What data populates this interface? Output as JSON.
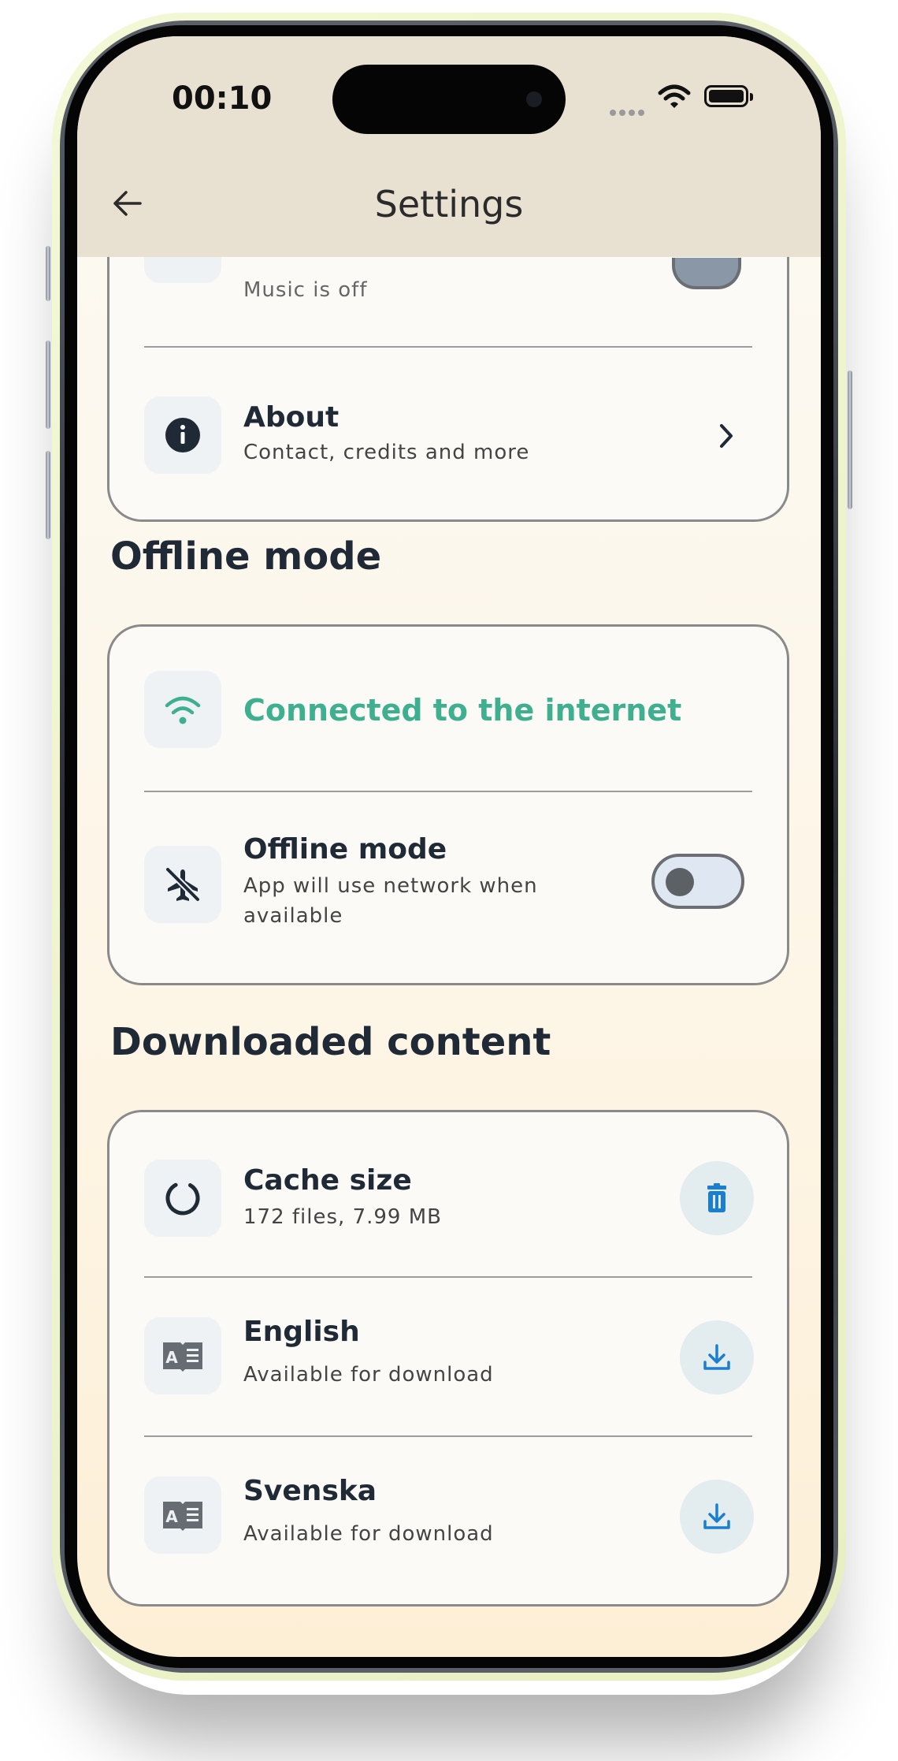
{
  "status_bar": {
    "time": "00:10"
  },
  "app_bar": {
    "title": "Settings",
    "back_icon": "arrow-left-icon"
  },
  "top_card": {
    "partial_item_subtitle": "Music is off",
    "about": {
      "title": "About",
      "subtitle": "Contact, credits and more",
      "icon": "info-icon",
      "trailing": "chevron-right-icon"
    }
  },
  "offline_section": {
    "heading": "Offline mode",
    "connection": {
      "label": "Connected to the internet",
      "icon": "wifi-icon",
      "color": "#3fb08f"
    },
    "offline_toggle": {
      "title": "Offline mode",
      "subtitle_line1": "App will use network when",
      "subtitle_line2": "available",
      "icon": "airplane-off-icon",
      "enabled": false
    }
  },
  "downloaded_section": {
    "heading": "Downloaded content",
    "items": [
      {
        "title": "Cache size",
        "subtitle": "172 files, 7.99 MB",
        "icon": "loading-ring-icon",
        "action_icon": "trash-icon"
      },
      {
        "title": "English",
        "subtitle": "Available for download",
        "icon": "book-language-icon",
        "action_icon": "download-icon"
      },
      {
        "title": "Svenska",
        "subtitle": "Available for download",
        "icon": "book-language-icon",
        "action_icon": "download-icon"
      }
    ]
  },
  "colors": {
    "accent_blue": "#1a7fd0",
    "accent_green": "#3fb08f",
    "header_bg": "#e8e1d2"
  }
}
